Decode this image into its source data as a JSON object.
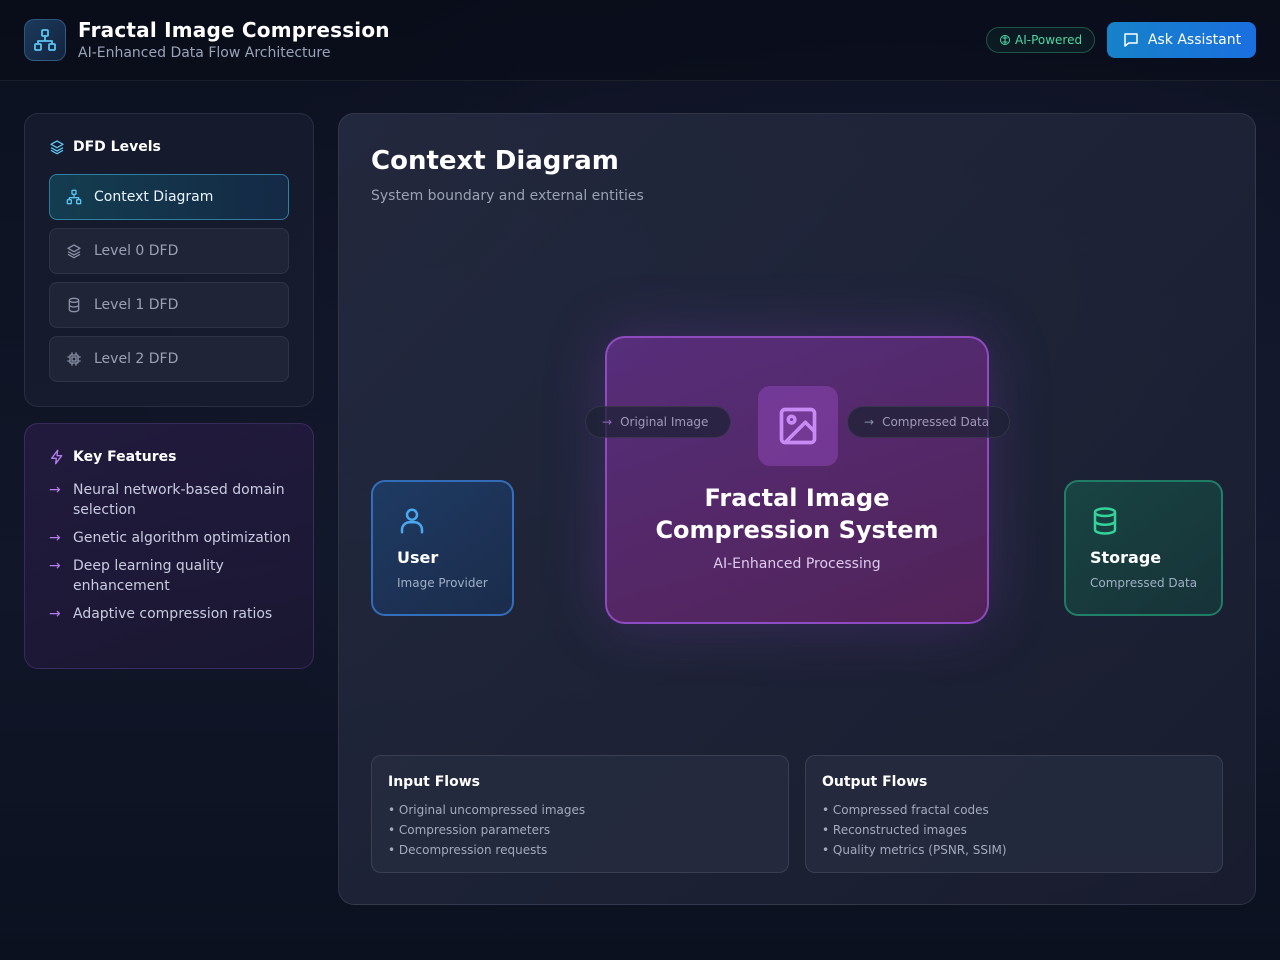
{
  "header": {
    "title": "Fractal Image Compression",
    "subtitle": "AI-Enhanced Data Flow Architecture",
    "badge": "AI-Powered",
    "assistant_button": "Ask Assistant"
  },
  "sidebar": {
    "levels_heading": "DFD Levels",
    "levels": [
      {
        "label": "Context Diagram",
        "icon": "network-icon",
        "active": true
      },
      {
        "label": "Level 0 DFD",
        "icon": "layers-icon",
        "active": false
      },
      {
        "label": "Level 1 DFD",
        "icon": "database-icon",
        "active": false
      },
      {
        "label": "Level 2 DFD",
        "icon": "chip-icon",
        "active": false
      }
    ],
    "features_heading": "Key Features",
    "features": [
      "Neural network-based domain selection",
      "Genetic algorithm optimization",
      "Deep learning quality enhancement",
      "Adaptive compression ratios"
    ]
  },
  "main": {
    "title": "Context Diagram",
    "subtitle": "System boundary and external entities",
    "user": {
      "name": "User",
      "role": "Image Provider"
    },
    "storage": {
      "name": "Storage",
      "role": "Compressed Data"
    },
    "system": {
      "title_line1": "Fractal Image",
      "title_line2": "Compression System",
      "subtitle": "AI-Enhanced Processing"
    },
    "flow_in_label": "Original Image",
    "flow_out_label": "Compressed Data",
    "input_flows": {
      "title": "Input Flows",
      "items": [
        "• Original uncompressed images",
        "• Compression parameters",
        "• Decompression requests"
      ]
    },
    "output_flows": {
      "title": "Output Flows",
      "items": [
        "• Compressed fractal codes",
        "• Reconstructed images",
        "• Quality metrics (PSNR, SSIM)"
      ]
    }
  },
  "colors": {
    "accent_blue": "#1a6fe0",
    "accent_purple": "#a855f7",
    "accent_green": "#34d399",
    "accent_cyan": "#38bdf8"
  }
}
